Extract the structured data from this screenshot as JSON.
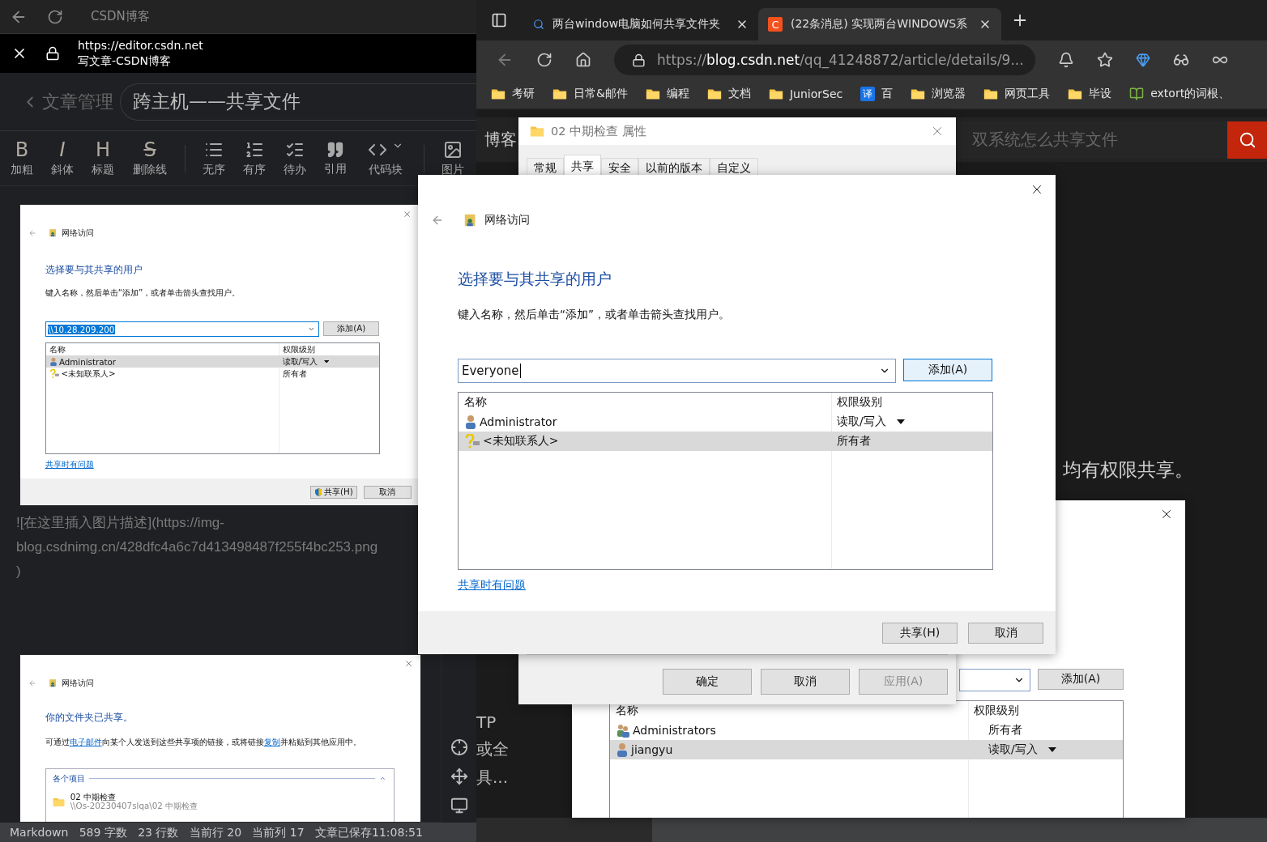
{
  "editor": {
    "app_title": "CSDN博客",
    "url": "https://editor.csdn.net",
    "page_title": "写文章-CSDN博客",
    "back_label": "文章管理",
    "article_title": "跨主机——共享文件",
    "toolbar": [
      {
        "kind": "bold",
        "glyph": "B",
        "label": "加粗"
      },
      {
        "kind": "italic",
        "glyph": "I",
        "label": "斜体"
      },
      {
        "kind": "heading",
        "glyph": "H",
        "label": "标题"
      },
      {
        "kind": "strike",
        "glyph": "S",
        "label": "删除线"
      },
      {
        "kind": "bullets",
        "label": "无序"
      },
      {
        "kind": "numbers",
        "label": "有序"
      },
      {
        "kind": "todo",
        "label": "待办"
      },
      {
        "kind": "quote",
        "label": "引用"
      },
      {
        "kind": "code",
        "label": "代码块"
      },
      {
        "kind": "image",
        "label": "图片"
      }
    ],
    "content": [
      {
        "kind": "share_dialog",
        "header": "网络访问",
        "heading": "选择要与其共享的用户",
        "instruction": "键入名称，然后单击“添加”，或者单击箭头查找用户。",
        "field_value": "\\\\10.28.209.200",
        "value_selected": true,
        "add_button": {
          "label": "添加(A)",
          "highlighted": false
        },
        "columns": [
          "名称",
          "权限级别"
        ],
        "rows": [
          {
            "kind": "user",
            "name": "Administrator",
            "permission": "读取/写入",
            "dropdown": true,
            "selected": true
          },
          {
            "kind": "unknown",
            "name": "<未知联系人>",
            "permission": "所有者",
            "dropdown": false,
            "selected": false
          }
        ],
        "link": "共享时有问题",
        "buttons": [
          {
            "label": "共享(H)",
            "shield": true
          },
          {
            "label": "取消",
            "shield": false
          }
        ]
      },
      {
        "kind": "text",
        "lines": [
          "![在这里插入图片描述](https://img-",
          "blog.csdnimg.cn/428dfc4a6c7d413498487f255f4bc253.png",
          ")"
        ]
      },
      {
        "kind": "shared_dialog",
        "header": "网络访问",
        "heading": "你的文件夹已共享。",
        "message": [
          {
            "text": "可通过",
            "link": false
          },
          {
            "text": "电子邮件",
            "link": true
          },
          {
            "text": "向某个人发送到这些共享项的链接，或将链接",
            "link": false
          },
          {
            "text": "复制",
            "link": true
          },
          {
            "text": "并粘贴到其他应用中。",
            "link": false
          }
        ],
        "group_label": "各个项目",
        "expanded": true,
        "items": [
          {
            "name": "02 中期检查",
            "path": "\\\\Os-20230407slqa\\02 中期检查"
          }
        ]
      }
    ],
    "status_bar": "Markdown   589 字数   23 行数   当前行 20   当前列 17   文章已保存11:08:51"
  },
  "browser": {
    "tabs": [
      {
        "kind": "search",
        "title": "两台window电脑如何共享文件夹",
        "selected": false
      },
      {
        "kind": "site",
        "favicon_text": "C",
        "title": "(22条消息) 实现两台WINDOWS系",
        "selected": true
      }
    ],
    "url_scheme": "https://",
    "url_host": "blog.csdn.net",
    "url_path": "/qq_41248872/article/details/9...",
    "bookmarks": [
      {
        "kind": "folder",
        "label": "考研"
      },
      {
        "kind": "folder",
        "label": "日常&邮件"
      },
      {
        "kind": "folder",
        "label": "编程"
      },
      {
        "kind": "folder",
        "label": "文档"
      },
      {
        "kind": "folder",
        "label": "JuniorSec"
      },
      {
        "kind": "translate",
        "icon_text": "译",
        "label": "百"
      },
      {
        "kind": "folder",
        "label": "浏览器"
      },
      {
        "kind": "folder",
        "label": "网页工具"
      },
      {
        "kind": "folder",
        "label": "毕设"
      },
      {
        "kind": "book",
        "label": "extort的词根、"
      }
    ],
    "page": {
      "brand": "博客",
      "search_placeholder": "双系统怎么共享文件",
      "body_text": "均有权限共享。",
      "side_texts": [
        "TP",
        "或全",
        "具..."
      ]
    }
  },
  "properties_dialog": {
    "title": "02 中期检查 属性",
    "tabs": [
      {
        "label": "常规",
        "selected": false
      },
      {
        "label": "共享",
        "selected": true
      },
      {
        "label": "安全",
        "selected": false
      },
      {
        "label": "以前的版本",
        "selected": false
      },
      {
        "label": "自定义",
        "selected": false
      }
    ],
    "buttons": [
      {
        "label": "确定",
        "disabled": false
      },
      {
        "label": "取消",
        "disabled": false
      },
      {
        "label": "应用(A)",
        "disabled": true
      }
    ]
  },
  "back_share_dialog": {
    "add_label": "添加(A)",
    "columns": [
      "名称",
      "权限级别"
    ],
    "rows": [
      {
        "kind": "group",
        "name": "Administrators",
        "permission": "所有者",
        "dropdown": false,
        "selected": false
      },
      {
        "kind": "user",
        "name": "jiangyu",
        "permission": "读取/写入",
        "dropdown": true,
        "selected": true
      }
    ]
  },
  "share_dialog": {
    "header": "网络访问",
    "heading": "选择要与其共享的用户",
    "instruction": "键入名称，然后单击“添加”，或者单击箭头查找用户。",
    "field_value": "Everyone",
    "value_selected": false,
    "add_button": {
      "label": "添加(A)",
      "highlighted": true
    },
    "columns": [
      "名称",
      "权限级别"
    ],
    "rows": [
      {
        "kind": "user",
        "name": "Administrator",
        "permission": "读取/写入",
        "dropdown": true,
        "selected": false
      },
      {
        "kind": "unknown",
        "name": "<未知联系人>",
        "permission": "所有者",
        "dropdown": false,
        "selected": true
      }
    ],
    "link": "共享时有问题",
    "buttons": [
      {
        "label": "共享(H)",
        "shield": false
      },
      {
        "label": "取消",
        "shield": false
      }
    ]
  }
}
